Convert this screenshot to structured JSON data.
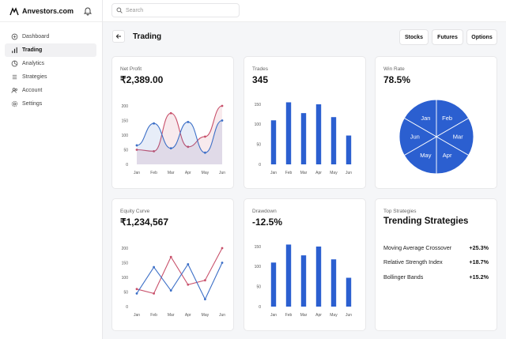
{
  "brand": {
    "name": "Anvestors.com"
  },
  "search": {
    "placeholder": "Search"
  },
  "sidebar": {
    "items": [
      {
        "label": "Dashboard",
        "icon": "grid-icon"
      },
      {
        "label": "Trading",
        "icon": "bar-chart-icon",
        "active": true
      },
      {
        "label": "Analytics",
        "icon": "pie-icon"
      },
      {
        "label": "Strategies",
        "icon": "list-icon"
      },
      {
        "label": "Account",
        "icon": "users-icon"
      },
      {
        "label": "Settings",
        "icon": "gear-icon"
      }
    ]
  },
  "header": {
    "title": "Trading",
    "buttons": [
      "Stocks",
      "Futures",
      "Options"
    ]
  },
  "colors": {
    "red": "#c8506a",
    "blue": "#3c6fc7",
    "bar": "#2b5fd0",
    "pie": "#2b5fd0"
  },
  "cards": {
    "net_profit": {
      "label": "Net Profit",
      "value": "₹2,389.00"
    },
    "trades": {
      "label": "Trades",
      "value": "345"
    },
    "win_rate": {
      "label": "Win Rate",
      "value": "78.5%"
    },
    "equity": {
      "label": "Equity Curve",
      "value": "₹1,234,567"
    },
    "drawdown": {
      "label": "Drawdown",
      "value": "-12.5%"
    },
    "strategies": {
      "label": "Top Strategies",
      "title": "Trending Strategies",
      "items": [
        {
          "name": "Moving Average Crossover",
          "value": "+25.3%"
        },
        {
          "name": "Relative Strength Index",
          "value": "+18.7%"
        },
        {
          "name": "Bollinger Bands",
          "value": "+15.2%"
        }
      ]
    }
  },
  "chart_data": [
    {
      "id": "net_profit",
      "type": "area",
      "categories": [
        "Jan",
        "Feb",
        "Mar",
        "Apr",
        "May",
        "Jun"
      ],
      "y_ticks": [
        "0",
        "50",
        "100",
        "150",
        "200"
      ],
      "ylim": [
        0,
        200
      ],
      "series": [
        {
          "color": "red",
          "values": [
            50,
            45,
            175,
            60,
            95,
            200
          ]
        },
        {
          "color": "blue",
          "values": [
            65,
            140,
            55,
            145,
            40,
            150
          ]
        }
      ]
    },
    {
      "id": "trades",
      "type": "bar",
      "categories": [
        "Jan",
        "Feb",
        "Mar",
        "Apr",
        "May",
        "Jun"
      ],
      "y_ticks": [
        "0",
        "50",
        "100",
        "150"
      ],
      "ylim": [
        0,
        150
      ],
      "values": [
        110,
        155,
        128,
        150,
        118,
        72
      ]
    },
    {
      "id": "win_rate",
      "type": "pie",
      "categories": [
        "Jan",
        "Feb",
        "Mar",
        "Apr",
        "May",
        "Jun"
      ],
      "values": [
        1,
        1,
        1,
        1,
        1,
        1
      ]
    },
    {
      "id": "equity",
      "type": "line",
      "categories": [
        "Jan",
        "Feb",
        "Mar",
        "Apr",
        "May",
        "Jun"
      ],
      "y_ticks": [
        "0",
        "50",
        "100",
        "150",
        "200"
      ],
      "ylim": [
        0,
        200
      ],
      "series": [
        {
          "color": "red",
          "values": [
            60,
            45,
            170,
            75,
            90,
            200
          ]
        },
        {
          "color": "blue",
          "values": [
            45,
            135,
            55,
            145,
            25,
            150
          ]
        }
      ]
    },
    {
      "id": "drawdown",
      "type": "bar",
      "categories": [
        "Jan",
        "Feb",
        "Mar",
        "Apr",
        "May",
        "Jun"
      ],
      "y_ticks": [
        "0",
        "50",
        "100",
        "150"
      ],
      "ylim": [
        0,
        150
      ],
      "values": [
        110,
        155,
        128,
        150,
        118,
        72
      ]
    }
  ]
}
